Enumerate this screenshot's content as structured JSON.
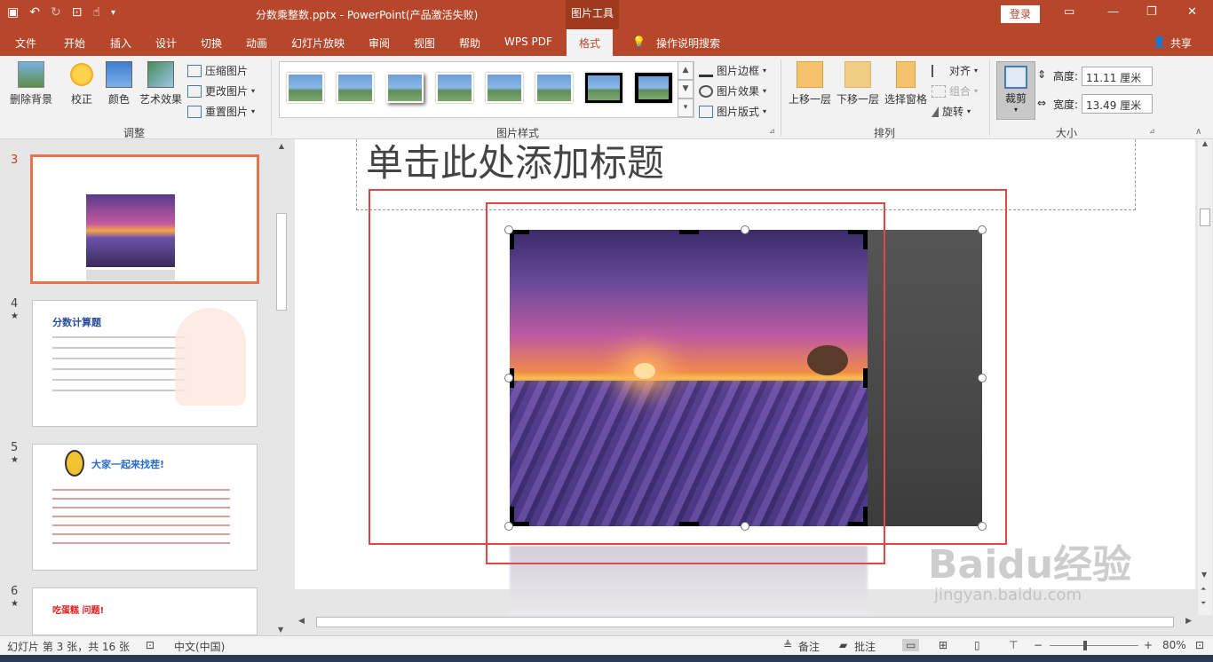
{
  "titlebar": {
    "doc_title": "分数乘整数.pptx  -  PowerPoint(产品激活失败)",
    "context_tab_header": "图片工具",
    "login_label": "登录"
  },
  "menu": {
    "tabs": [
      "文件",
      "开始",
      "插入",
      "设计",
      "切换",
      "动画",
      "幻灯片放映",
      "审阅",
      "视图",
      "帮助",
      "WPS PDF",
      "格式"
    ],
    "active_tab": "格式",
    "tell_me": "操作说明搜索",
    "share": "共享"
  },
  "ribbon": {
    "adjust": {
      "remove_bg": "删除背景",
      "correct": "校正",
      "color": "颜色",
      "art_effects": "艺术效果",
      "compress": "压缩图片",
      "change": "更改图片",
      "reset": "重置图片",
      "group_label": "调整"
    },
    "styles": {
      "border": "图片边框",
      "effects": "图片效果",
      "layout": "图片版式",
      "group_label": "图片样式"
    },
    "arrange": {
      "bring_forward": "上移一层",
      "send_backward": "下移一层",
      "selection_pane": "选择窗格",
      "align": "对齐",
      "group": "组合",
      "rotate": "旋转",
      "group_label": "排列"
    },
    "size": {
      "crop": "裁剪",
      "height_label": "高度:",
      "height_value": "11.11 厘米",
      "width_label": "宽度:",
      "width_value": "13.49 厘米",
      "group_label": "大小"
    }
  },
  "slides": {
    "items": [
      {
        "num": "3",
        "star": ""
      },
      {
        "num": "4",
        "star": "★",
        "title": "分数计算题"
      },
      {
        "num": "5",
        "star": "★",
        "title": "大家一起来找茬!"
      },
      {
        "num": "6",
        "star": "★",
        "title": "吃蛋糕  问题!"
      }
    ]
  },
  "editor": {
    "title_placeholder": "单击此处添加标题"
  },
  "status": {
    "slide_info": "幻灯片 第 3 张，共 16 张",
    "language": "中文(中国)",
    "notes": "备注",
    "comments": "批注",
    "zoom": "80%"
  },
  "watermark": {
    "brand": "Baidu经验",
    "url": "jingyan.baidu.com"
  }
}
